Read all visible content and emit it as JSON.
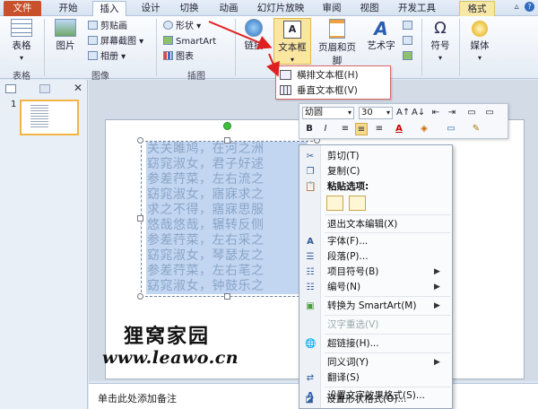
{
  "tabs": [
    {
      "label": "文件",
      "kind": "file"
    },
    {
      "label": "开始",
      "kind": "normal"
    },
    {
      "label": "插入",
      "kind": "active"
    },
    {
      "label": "设计",
      "kind": "normal"
    },
    {
      "label": "切换",
      "kind": "normal"
    },
    {
      "label": "动画",
      "kind": "normal"
    },
    {
      "label": "幻灯片放映",
      "kind": "normal"
    },
    {
      "label": "审阅",
      "kind": "normal"
    },
    {
      "label": "视图",
      "kind": "normal"
    },
    {
      "label": "开发工具",
      "kind": "normal"
    },
    {
      "label": "格式",
      "kind": "contextual"
    }
  ],
  "ribbon": {
    "table": {
      "label": "表格",
      "group": "表格"
    },
    "images": {
      "picture": "图片",
      "clipart": "剪贴画",
      "screenshot": "屏幕截图",
      "album": "相册",
      "group": "图像"
    },
    "illustrations": {
      "shapes": "形状",
      "smartart": "SmartArt",
      "chart": "图表",
      "group": "插图"
    },
    "link": "链接",
    "textbox": "文本框",
    "header_footer": "页眉和页脚",
    "wordart": "艺术字",
    "symbol": "符号",
    "media": "媒体"
  },
  "textbox_dropdown": {
    "items": [
      {
        "label": "横排文本框(H)"
      },
      {
        "label": "垂直文本框(V)"
      }
    ]
  },
  "slide_panel": {
    "slide_number": "1"
  },
  "slide_text": [
    "关关雎鸠，在河之洲",
    "窈窕淑女，君子好逑",
    "参差荇菜，左右流之",
    "窈窕淑女，寤寐求之",
    "求之不得，寤寐思服",
    "悠哉悠哉，辗转反侧",
    "参差荇菜，左右采之",
    "窈窕淑女，琴瑟友之",
    "参差荇菜，左右芼之",
    "窈窕淑女，钟鼓乐之"
  ],
  "watermark": {
    "line1": "狸窝家园",
    "line2": "www.leawo.cn"
  },
  "notes": {
    "placeholder": "单击此处添加备注"
  },
  "mini_toolbar": {
    "font": "幼圆",
    "size": "30",
    "buttons_row1": [
      "A↑",
      "A↓",
      "⇤",
      "⇥",
      "▭",
      "▭"
    ],
    "buttons_row2": [
      "B",
      "I",
      "≡",
      "≡",
      "≡",
      "A",
      "◈",
      "▭",
      "✎"
    ]
  },
  "context_menu": {
    "items": [
      {
        "label": "剪切(T)",
        "icon": "scissors-icon",
        "glyph": "✂",
        "disabled": false,
        "submenu": false
      },
      {
        "label": "复制(C)",
        "icon": "copy-icon",
        "glyph": "❐",
        "disabled": false,
        "submenu": false
      },
      {
        "label": "粘贴选项:",
        "icon": "paste-icon",
        "glyph": "📋",
        "disabled": false,
        "submenu": false,
        "bold": true
      },
      {
        "label": "退出文本编辑(X)",
        "icon": "",
        "glyph": "",
        "disabled": false,
        "submenu": false
      },
      {
        "label": "字体(F)...",
        "icon": "font-icon",
        "glyph": "A",
        "disabled": false,
        "submenu": false
      },
      {
        "label": "段落(P)...",
        "icon": "paragraph-icon",
        "glyph": "☰",
        "disabled": false,
        "submenu": false
      },
      {
        "label": "项目符号(B)",
        "icon": "bullets-icon",
        "glyph": "☷",
        "disabled": false,
        "submenu": true
      },
      {
        "label": "编号(N)",
        "icon": "numbering-icon",
        "glyph": "☷",
        "disabled": false,
        "submenu": true
      },
      {
        "label": "转换为 SmartArt(M)",
        "icon": "smartart-icon",
        "glyph": "▣",
        "disabled": false,
        "submenu": true
      },
      {
        "label": "汉字重选(V)",
        "icon": "",
        "glyph": "",
        "disabled": true,
        "submenu": false
      },
      {
        "label": "超链接(H)...",
        "icon": "hyperlink-icon",
        "glyph": "🌐",
        "disabled": false,
        "submenu": false
      },
      {
        "label": "同义词(Y)",
        "icon": "",
        "glyph": "",
        "disabled": false,
        "submenu": true
      },
      {
        "label": "翻译(S)",
        "icon": "translate-icon",
        "glyph": "⇄",
        "disabled": false,
        "submenu": false
      },
      {
        "label": "设置文字效果格式(S)...",
        "icon": "text-effects-icon",
        "glyph": "A",
        "disabled": false,
        "submenu": false
      },
      {
        "label": "设置形状格式(O)...",
        "icon": "shape-format-icon",
        "glyph": "◪",
        "disabled": false,
        "submenu": false
      }
    ]
  },
  "colors": {
    "file_tab": "#c8512b",
    "arrow": "#e02020",
    "selection": "#78a5e1"
  }
}
